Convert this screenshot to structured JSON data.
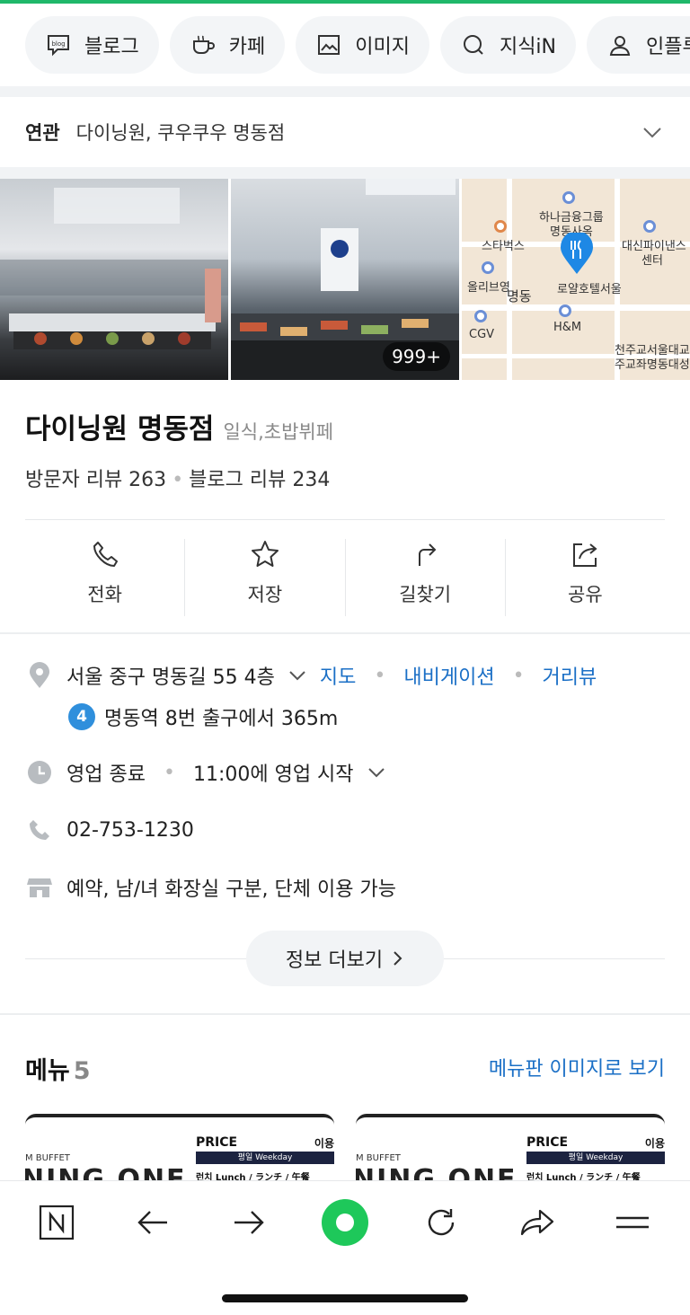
{
  "chips": [
    {
      "label": "블로그",
      "icon": "blog-icon"
    },
    {
      "label": "카페",
      "icon": "cafe-cup-icon"
    },
    {
      "label": "이미지",
      "icon": "image-icon"
    },
    {
      "label": "지식iN",
      "icon": "knowledge-search-icon"
    },
    {
      "label": "인플루",
      "icon": "person-icon"
    }
  ],
  "related": {
    "label": "연관",
    "value": "다이닝원, 쿠우쿠우 명동점"
  },
  "photos": {
    "count_badge": "999+"
  },
  "map": {
    "labels": [
      "하나금융그룹",
      "명동사옥",
      "스타벅스",
      "대신파이낸스",
      "센터",
      "올리브영",
      "명동",
      "로얄호텔서울",
      "CGV",
      "H&M",
      "천주교서울대교",
      "주교좌명동대성"
    ]
  },
  "place": {
    "name": "다이닝원 명동점",
    "category": "일식,초밥뷔페",
    "visitor_reviews": "방문자 리뷰 263",
    "blog_reviews": "블로그 리뷰 234"
  },
  "actions": [
    {
      "label": "전화",
      "icon": "phone-icon"
    },
    {
      "label": "저장",
      "icon": "star-icon"
    },
    {
      "label": "길찾기",
      "icon": "directions-icon"
    },
    {
      "label": "공유",
      "icon": "share-icon"
    }
  ],
  "info": {
    "address": "서울 중구 명동길 55 4층",
    "map_link": "지도",
    "navi_link": "내비게이션",
    "street_link": "거리뷰",
    "subway_line": "4",
    "subway_text": "명동역 8번 출구에서 365m",
    "hours_status": "영업 종료",
    "hours_text": "11:00에 영업 시작",
    "phone": "02-753-1230",
    "facilities": "예약, 남/녀 화장실 구분, 단체 이용 가능",
    "more_label": "정보 더보기"
  },
  "menu": {
    "title": "메뉴",
    "count": "5",
    "image_link": "메뉴판 이미지로 보기",
    "card_small": "M BUFFET",
    "card_big": "NING ONE",
    "card_price": "PRICE",
    "card_use": "이용",
    "card_weekday": "평일 Weekday",
    "card_lunch": "런치 Lunch / ランチ / 午餐"
  },
  "colors": {
    "accent_green": "#1ec85a",
    "link_blue": "#1a6fc6",
    "top_line": "#1fb86a"
  }
}
